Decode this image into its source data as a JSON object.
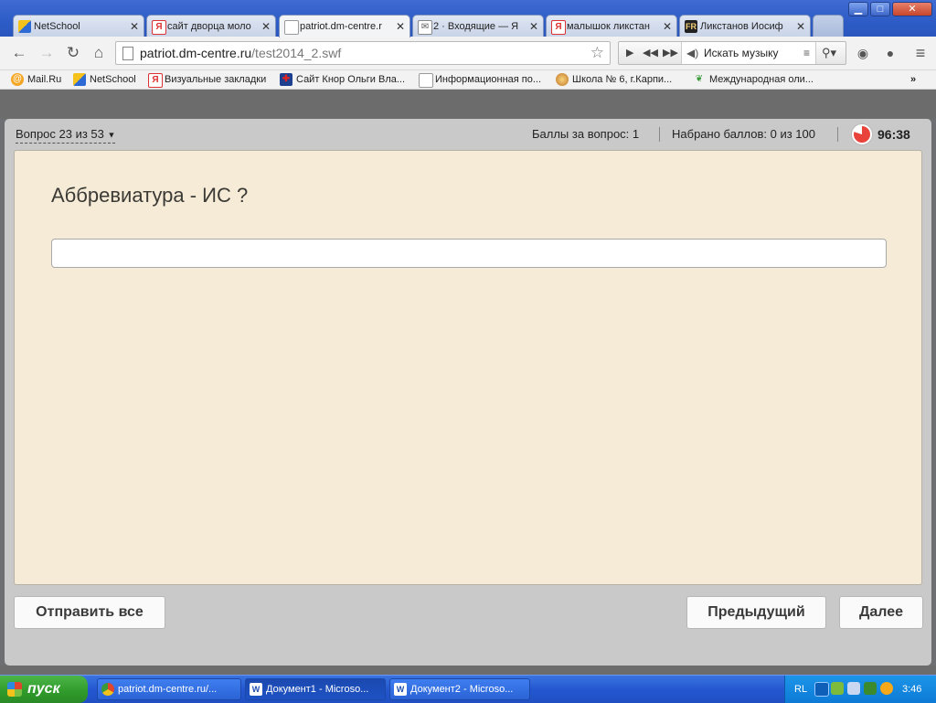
{
  "window": {
    "controls": {
      "minimize": "▁",
      "maximize": "□",
      "close": "✕"
    }
  },
  "tabs": [
    {
      "label": "NetSchool",
      "active": false
    },
    {
      "label": "сайт дворца моло",
      "active": false
    },
    {
      "label": "patriot.dm-centre.r",
      "active": true
    },
    {
      "label": "2 · Входящие — Я",
      "active": false
    },
    {
      "label": "малышок ликстан",
      "active": false
    },
    {
      "label": "Ликстанов Иосиф",
      "active": false
    }
  ],
  "toolbar": {
    "url_host": "patriot.dm-centre.ru",
    "url_path": "/test2014_2.swf",
    "music_search_placeholder": "Искать музыку"
  },
  "bookmarks": [
    {
      "label": "Mail.Ru",
      "icon": "mailru-icon"
    },
    {
      "label": "NetSchool",
      "icon": "netschool-icon"
    },
    {
      "label": "Визуальные закладки",
      "icon": "yandex-icon"
    },
    {
      "label": "Сайт Кнор Ольги Вла...",
      "icon": "uk-flag-icon"
    },
    {
      "label": "Информационная по...",
      "icon": "page-icon"
    },
    {
      "label": "Школа № 6, г.Карпи...",
      "icon": "school-icon"
    },
    {
      "label": "Международная оли...",
      "icon": "leaf-icon"
    }
  ],
  "bookmarks_more": "»",
  "quiz": {
    "question_selector": "Вопрос 23 из 53",
    "points_per_question": "Баллы за вопрос: 1",
    "score": "Набрано баллов: 0 из 100",
    "timer": "96:38",
    "question": "Аббревиатура - ИС ?",
    "answer_value": "",
    "submit_all": "Отправить все",
    "previous": "Предыдущий",
    "next": "Далее"
  },
  "taskbar": {
    "start": "пуск",
    "tasks": [
      {
        "label": "patriot.dm-centre.ru/...",
        "icon": "chrome-icon",
        "active": false
      },
      {
        "label": "Документ1 - Microso...",
        "icon": "word-icon",
        "active": true
      },
      {
        "label": "Документ2 - Microso...",
        "icon": "word-icon",
        "active": false
      }
    ],
    "language": "RL",
    "clock": "3:46"
  }
}
